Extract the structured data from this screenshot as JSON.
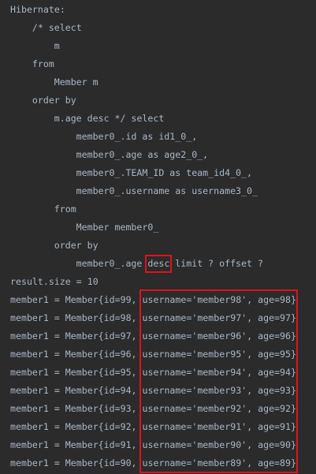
{
  "console": {
    "sql": [
      {
        "indent": 0,
        "text": "Hibernate:"
      },
      {
        "indent": 4,
        "text": "/* select"
      },
      {
        "indent": 8,
        "text": "m"
      },
      {
        "indent": 4,
        "text": "from"
      },
      {
        "indent": 8,
        "text": "Member m"
      },
      {
        "indent": 4,
        "text": "order by"
      },
      {
        "indent": 8,
        "text": "m.age desc */ select"
      },
      {
        "indent": 12,
        "text": "member0_.id as id1_0_,"
      },
      {
        "indent": 12,
        "text": "member0_.age as age2_0_,"
      },
      {
        "indent": 12,
        "text": "member0_.TEAM_ID as team_id4_0_,"
      },
      {
        "indent": 12,
        "text": "member0_.username as username3_0_"
      },
      {
        "indent": 8,
        "text": "from"
      },
      {
        "indent": 12,
        "text": "Member member0_"
      },
      {
        "indent": 8,
        "text": "order by"
      }
    ],
    "order_line": {
      "indent": 12,
      "before": "member0_.age ",
      "keyword": "desc",
      "after": " limit ? offset ?"
    },
    "result_size": "result.size = 10",
    "members": [
      {
        "prefix": "member1 = Member{id=99, ",
        "rest": "username='member98', age=98}"
      },
      {
        "prefix": "member1 = Member{id=98, ",
        "rest": "username='member97', age=97}"
      },
      {
        "prefix": "member1 = Member{id=97, ",
        "rest": "username='member96', age=96}"
      },
      {
        "prefix": "member1 = Member{id=96, ",
        "rest": "username='member95', age=95}"
      },
      {
        "prefix": "member1 = Member{id=95, ",
        "rest": "username='member94', age=94}"
      },
      {
        "prefix": "member1 = Member{id=94, ",
        "rest": "username='member93', age=93}"
      },
      {
        "prefix": "member1 = Member{id=93, ",
        "rest": "username='member92', age=92}"
      },
      {
        "prefix": "member1 = Member{id=92, ",
        "rest": "username='member91', age=91}"
      },
      {
        "prefix": "member1 = Member{id=91, ",
        "rest": "username='member90', age=90}"
      },
      {
        "prefix": "member1 = Member{id=90, ",
        "rest": "username='member89', age=89}"
      }
    ],
    "colors": {
      "background": "#2b2b2b",
      "text": "#a9b7c6",
      "highlight_border": "#e0121b"
    }
  }
}
